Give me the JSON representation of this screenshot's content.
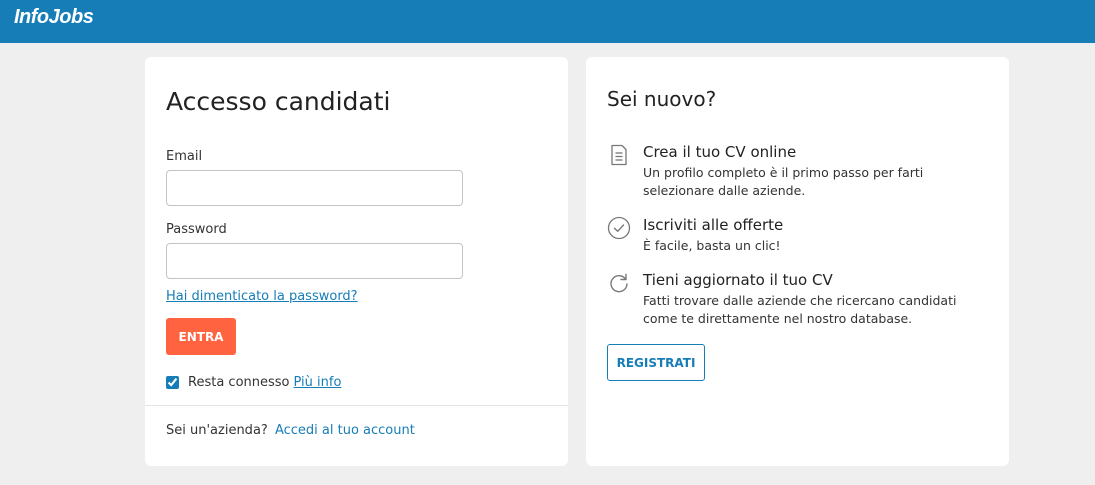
{
  "header": {
    "logo_text": "InfoJobs",
    "brand_color": "#167db7"
  },
  "login": {
    "title": "Accesso candidati",
    "email_label": "Email",
    "email_value": "",
    "password_label": "Password",
    "password_value": "",
    "forgot_link": "Hai dimenticato la password?",
    "submit_label": "ENTRA",
    "submit_color": "#ff6340",
    "remember_label": "Resta connesso",
    "remember_checked": true,
    "remember_info_link": "Più info",
    "company_prompt": "Sei un'azienda?",
    "company_link": "Accedi al tuo account"
  },
  "signup": {
    "title": "Sei nuovo?",
    "benefits": [
      {
        "icon": "document-icon",
        "title": "Crea il tuo CV online",
        "description": "Un profilo completo è il primo passo per farti selezionare dalle aziende."
      },
      {
        "icon": "check-circle-icon",
        "title": "Iscriviti alle offerte",
        "description": "È facile, basta un clic!"
      },
      {
        "icon": "refresh-icon",
        "title": "Tieni aggiornato il tuo CV",
        "description": "Fatti trovare dalle aziende che ricercano candidati come te direttamente nel nostro database."
      }
    ],
    "register_label": "REGISTRATI"
  }
}
